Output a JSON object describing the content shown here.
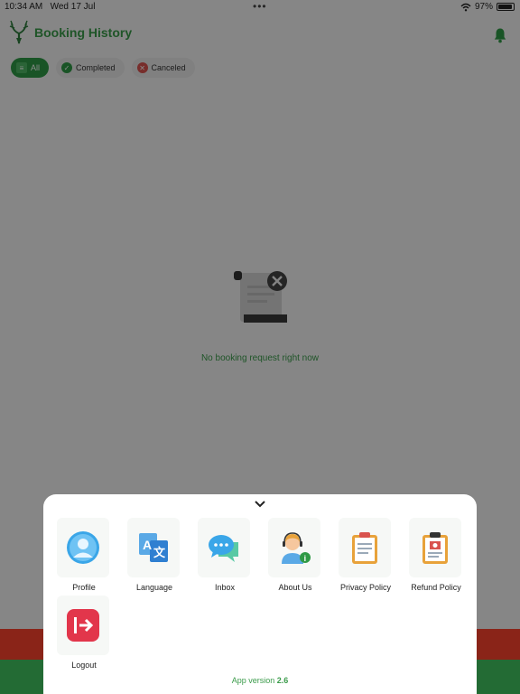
{
  "status_bar": {
    "time": "10:34 AM",
    "date": "Wed 17 Jul",
    "battery": "97%",
    "dots": "•••"
  },
  "header": {
    "title": "Booking History",
    "logo_icon": "deer-antler-logo-icon",
    "notification_icon": "bell-icon"
  },
  "filters": [
    {
      "label": "All",
      "icon": "list-icon",
      "active": true
    },
    {
      "label": "Completed",
      "icon": "check-circle-icon",
      "active": false
    },
    {
      "label": "Canceled",
      "icon": "x-circle-icon",
      "active": false
    }
  ],
  "empty_state": {
    "icon": "receipt-cancel-icon",
    "message": "No booking request right now"
  },
  "menu": {
    "items": [
      {
        "label": "Profile",
        "icon": "profile-icon"
      },
      {
        "label": "Language",
        "icon": "translate-icon"
      },
      {
        "label": "Inbox",
        "icon": "chat-icon"
      },
      {
        "label": "About Us",
        "icon": "support-agent-icon"
      },
      {
        "label": "Privacy Policy",
        "icon": "clipboard-icon"
      },
      {
        "label": "Refund Policy",
        "icon": "refund-document-icon"
      },
      {
        "label": "Logout",
        "icon": "logout-icon"
      }
    ],
    "version_label": "App version",
    "version_number": "2.6"
  },
  "colors": {
    "brand_green": "#3a9b4a",
    "active_chip": "#2f9a45",
    "danger_red": "#d9534f"
  }
}
